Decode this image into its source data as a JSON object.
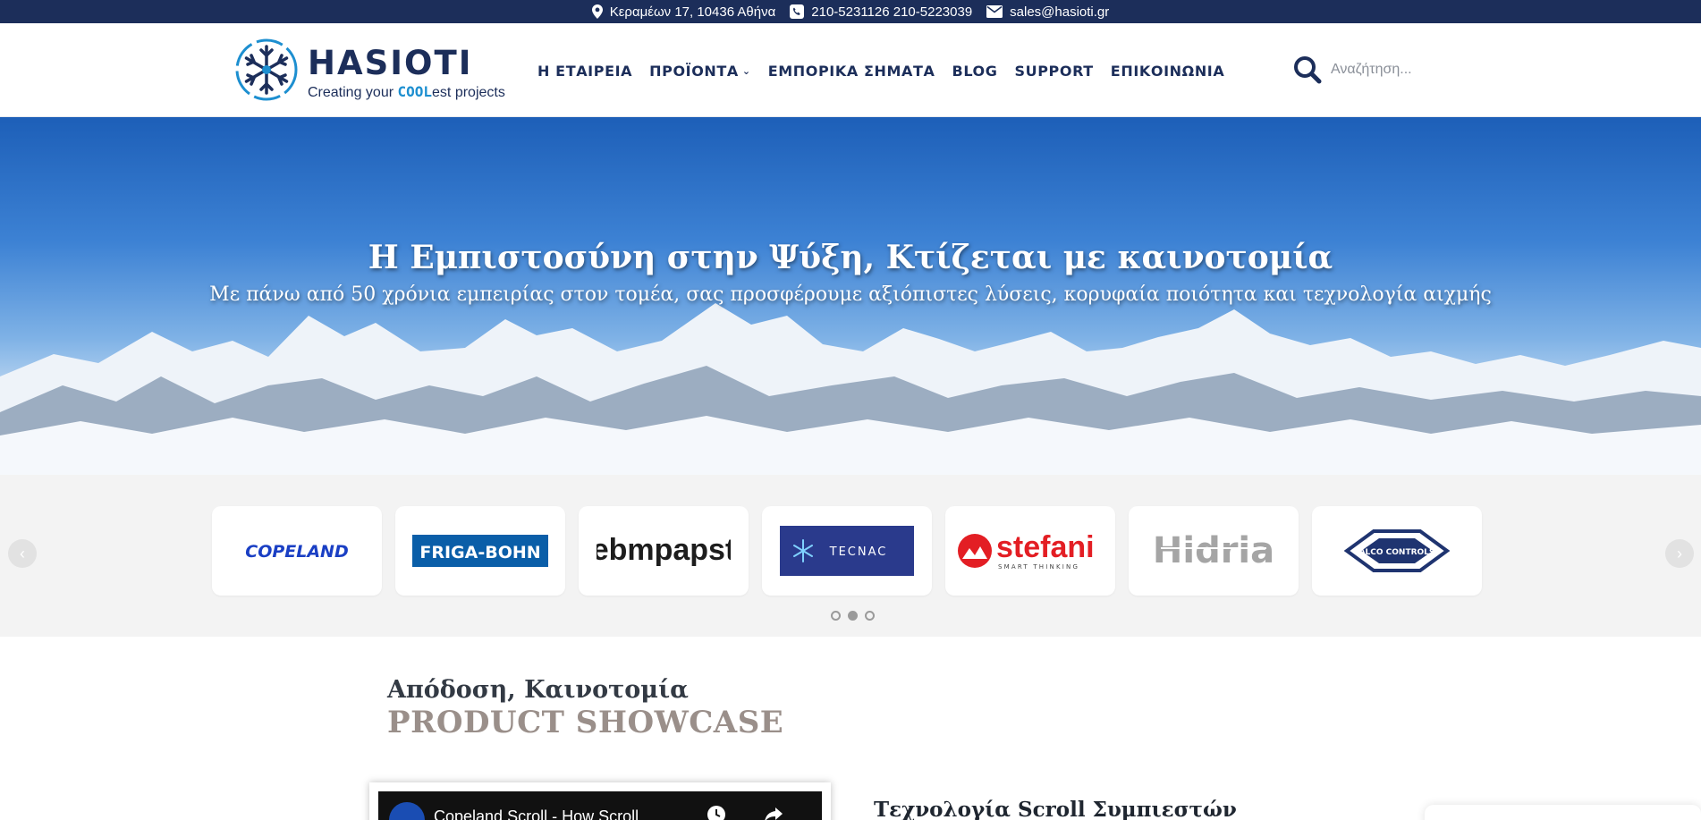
{
  "topbar": {
    "address": "Κεραμέων 17, 10436 Αθήνα",
    "phones": "210-5231126 210-5223039",
    "email": "sales@hasioti.gr"
  },
  "logo": {
    "wordmark": "HASIOTI",
    "tagline_pre": "Creating your ",
    "tagline_cool": "COOL",
    "tagline_post": "est projects"
  },
  "nav": {
    "items": [
      {
        "label": "Η ΕΤΑΙΡΕΙΑ"
      },
      {
        "label": "ΠΡΟΪΟΝΤΑ",
        "chevron": "⌄"
      },
      {
        "label": "ΕΜΠΟΡΙΚΑ ΣΗΜΑΤΑ"
      },
      {
        "label": "BLOG"
      },
      {
        "label": "SUPPORT"
      },
      {
        "label": "ΕΠΙΚΟΙΝΩΝΙΑ"
      }
    ]
  },
  "search": {
    "placeholder": "Αναζήτηση..."
  },
  "hero": {
    "title": "Η Εμπιστοσύνη στην Ψύξη, Κτίζεται με καινοτομία",
    "subtitle": "Με πάνω από 50 χρόνια εμπειρίας στον τομέα, σας προσφέρουμε αξιόπιστες λύσεις, κορυφαία ποιότητα και τεχνολογία αιχμής"
  },
  "brands": {
    "items": [
      "COPELAND",
      "FRIGA-BOHN",
      "ebmpapst",
      "TECNAC",
      "stefani",
      "Hidria",
      "ALCO CONTROLS"
    ],
    "stefani_tagline": "SMART THINKING",
    "prev_glyph": "‹",
    "next_glyph": "›"
  },
  "showcase": {
    "kicker": "Απόδοση, Καινοτομία",
    "title": "PRODUCT SHOWCASE",
    "video_title": "Copeland Scroll - How Scroll...",
    "heading": "Τεχνολογία Scroll Συμπιεστών"
  },
  "colors": {
    "navy": "#1c2e5a",
    "accent_blue": "#1d8fd0",
    "copeland_blue": "#1a3fc4",
    "friga_blue": "#0a5ea8",
    "tecnac_bg": "#2a3a8c",
    "stefani_red": "#e31e24",
    "hidria_gray": "#a5a5a5",
    "alco_navy": "#1f3470"
  }
}
